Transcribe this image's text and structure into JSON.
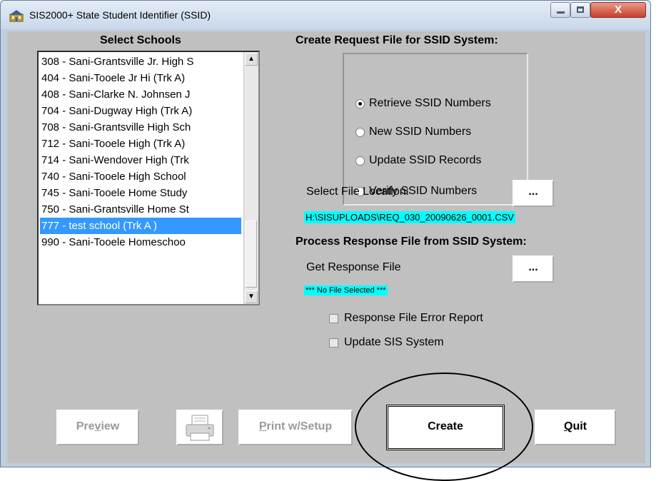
{
  "window": {
    "title": "SIS2000+ State Student Identifier (SSID)",
    "close_label": "X"
  },
  "schools": {
    "title": "Select Schools",
    "items": [
      "308 - Sani-Grantsville Jr. High S",
      "404 - Sani-Tooele Jr Hi (Trk A)",
      "408 - Sani-Clarke N. Johnsen J",
      "704 - Sani-Dugway High (Trk A)",
      "708 - Sani-Grantsville High Sch",
      "712 - Sani-Tooele High (Trk A)",
      "714 - Sani-Wendover High (Trk",
      "740 - Sani-Tooele High School",
      "745 - Sani-Tooele Home Study",
      "750 - Sani-Grantsville Home St",
      "777 - test school (Trk A )",
      "990 - Sani-Tooele Homeschoo"
    ],
    "selected_index": 10
  },
  "request": {
    "title": "Create Request File for SSID System:",
    "options": [
      "Retrieve SSID Numbers",
      "New SSID Numbers",
      "Update SSID Records",
      "Verify SSID Numbers"
    ],
    "selected_option": "Retrieve SSID Numbers",
    "file_location_label": "Select File Location:",
    "browse_label": "...",
    "file_path": "H:\\SISUPLOADS\\REQ_030_20090626_0001.CSV"
  },
  "process": {
    "title": "Process Response File from SSID System:",
    "get_response_label": "Get Response File",
    "browse_label": "...",
    "no_file_text": "*** No File Selected ***",
    "checkboxes": [
      "Response File Error Report",
      "Update SIS System"
    ]
  },
  "buttons": {
    "preview_before": "Pre",
    "preview_underlined": "v",
    "preview_after": "iew",
    "print_underlined": "P",
    "print_rest": "rint w/Setup",
    "create": "Create",
    "quit_underlined": "Q",
    "quit_rest": "uit"
  }
}
